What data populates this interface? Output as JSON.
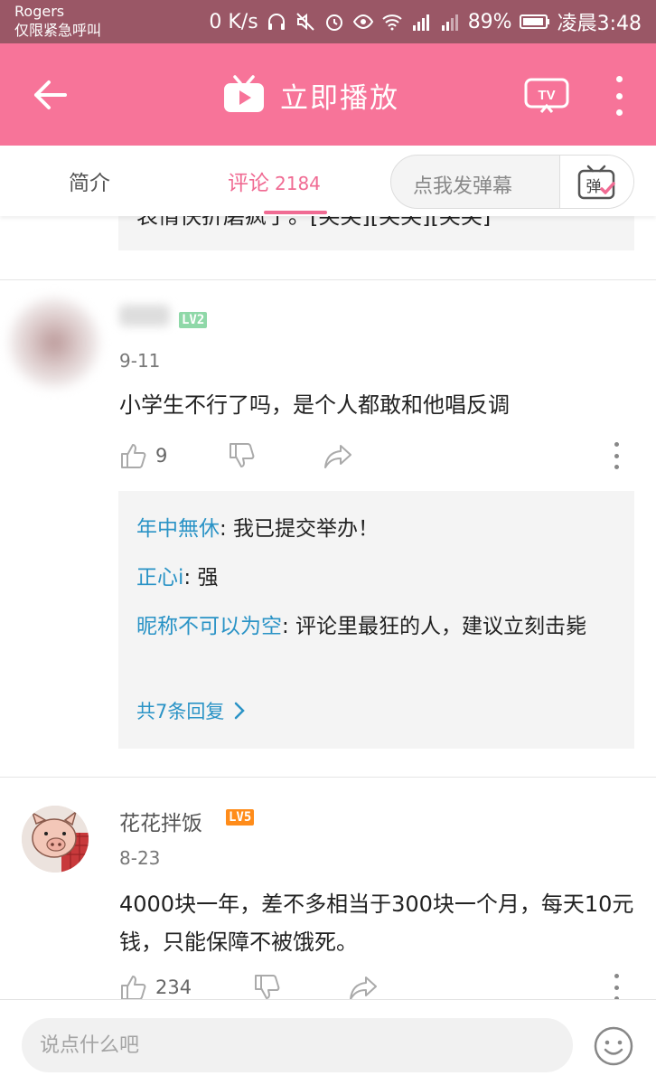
{
  "status_bar": {
    "carrier": "Rogers",
    "emergency": "仅限紧急呼叫",
    "net_speed": "0 K/s",
    "battery_pct": "89%",
    "time": "凌晨3:48"
  },
  "header": {
    "title": "立即播放",
    "tv_label": "TV"
  },
  "tabs": {
    "intro": "简介",
    "comments": "评论",
    "comments_count": "2184",
    "danmaku_placeholder": "点我发弹幕",
    "danmaku_icon_char": "弹"
  },
  "prev_comment_tail": "表情快折磨疯了。[笑笑][笑笑][笑笑]",
  "comments": [
    {
      "level": "LV2",
      "date": "9-11",
      "text": "小学生不行了吗，是个人都敢和他唱反调",
      "likes": "9",
      "replies": [
        {
          "name": "年中無休",
          "text": ": 我已提交举办！"
        },
        {
          "name": "正心i",
          "text": ": 强"
        },
        {
          "name": "昵称不可以为空",
          "text": ": 评论里最狂的人，建议立刻击毙"
        }
      ],
      "reply_all": "共7条回复"
    },
    {
      "name": "花花拌饭",
      "level": "LV5",
      "date": "8-23",
      "text": "4000块一年，差不多相当于300块一个月，每天10元钱，只能保障不被饿死。",
      "likes": "234"
    }
  ],
  "bottom": {
    "input_placeholder": "说点什么吧"
  },
  "colors": {
    "brand_pink": "#f77499",
    "tab_active": "#f06b93",
    "reply_name": "#2a93c6",
    "lv2": "#8fd8a8",
    "lv5": "#ff8c1a"
  }
}
